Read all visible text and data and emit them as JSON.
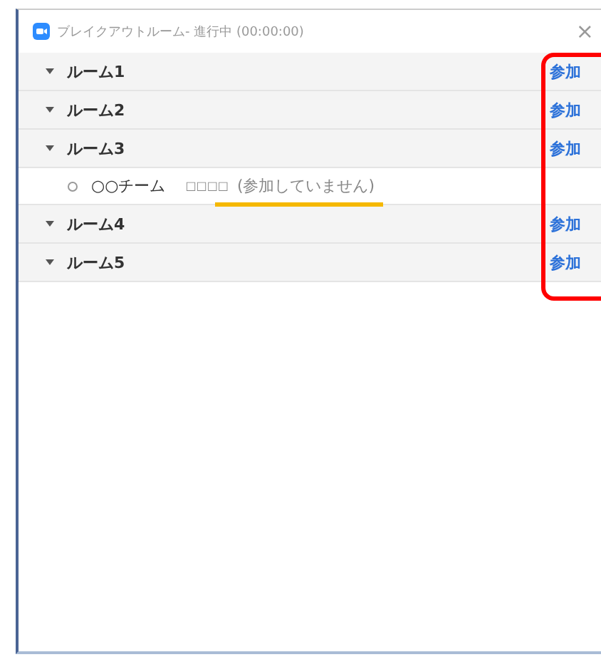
{
  "window": {
    "title": "ブレイクアウトルーム- 進行中 (00:00:00)",
    "close": "×"
  },
  "rooms": [
    {
      "name": "ルーム1",
      "join": "参加"
    },
    {
      "name": "ルーム2",
      "join": "参加"
    },
    {
      "name": "ルーム3",
      "join": "参加",
      "members": [
        {
          "name": "○○チーム",
          "tag": "□□□□",
          "status": "(参加していません)"
        }
      ]
    },
    {
      "name": "ルーム4",
      "join": "参加"
    },
    {
      "name": "ルーム5",
      "join": "参加"
    }
  ]
}
